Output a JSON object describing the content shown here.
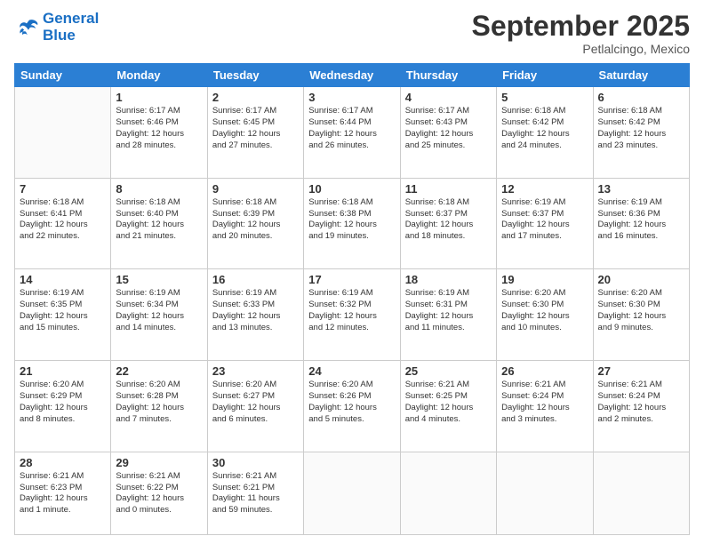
{
  "logo": {
    "line1": "General",
    "line2": "Blue"
  },
  "title": "September 2025",
  "location": "Petlalcingo, Mexico",
  "days_of_week": [
    "Sunday",
    "Monday",
    "Tuesday",
    "Wednesday",
    "Thursday",
    "Friday",
    "Saturday"
  ],
  "weeks": [
    [
      {
        "day": "",
        "content": ""
      },
      {
        "day": "1",
        "content": "Sunrise: 6:17 AM\nSunset: 6:46 PM\nDaylight: 12 hours\nand 28 minutes."
      },
      {
        "day": "2",
        "content": "Sunrise: 6:17 AM\nSunset: 6:45 PM\nDaylight: 12 hours\nand 27 minutes."
      },
      {
        "day": "3",
        "content": "Sunrise: 6:17 AM\nSunset: 6:44 PM\nDaylight: 12 hours\nand 26 minutes."
      },
      {
        "day": "4",
        "content": "Sunrise: 6:17 AM\nSunset: 6:43 PM\nDaylight: 12 hours\nand 25 minutes."
      },
      {
        "day": "5",
        "content": "Sunrise: 6:18 AM\nSunset: 6:42 PM\nDaylight: 12 hours\nand 24 minutes."
      },
      {
        "day": "6",
        "content": "Sunrise: 6:18 AM\nSunset: 6:42 PM\nDaylight: 12 hours\nand 23 minutes."
      }
    ],
    [
      {
        "day": "7",
        "content": "Sunrise: 6:18 AM\nSunset: 6:41 PM\nDaylight: 12 hours\nand 22 minutes."
      },
      {
        "day": "8",
        "content": "Sunrise: 6:18 AM\nSunset: 6:40 PM\nDaylight: 12 hours\nand 21 minutes."
      },
      {
        "day": "9",
        "content": "Sunrise: 6:18 AM\nSunset: 6:39 PM\nDaylight: 12 hours\nand 20 minutes."
      },
      {
        "day": "10",
        "content": "Sunrise: 6:18 AM\nSunset: 6:38 PM\nDaylight: 12 hours\nand 19 minutes."
      },
      {
        "day": "11",
        "content": "Sunrise: 6:18 AM\nSunset: 6:37 PM\nDaylight: 12 hours\nand 18 minutes."
      },
      {
        "day": "12",
        "content": "Sunrise: 6:19 AM\nSunset: 6:37 PM\nDaylight: 12 hours\nand 17 minutes."
      },
      {
        "day": "13",
        "content": "Sunrise: 6:19 AM\nSunset: 6:36 PM\nDaylight: 12 hours\nand 16 minutes."
      }
    ],
    [
      {
        "day": "14",
        "content": "Sunrise: 6:19 AM\nSunset: 6:35 PM\nDaylight: 12 hours\nand 15 minutes."
      },
      {
        "day": "15",
        "content": "Sunrise: 6:19 AM\nSunset: 6:34 PM\nDaylight: 12 hours\nand 14 minutes."
      },
      {
        "day": "16",
        "content": "Sunrise: 6:19 AM\nSunset: 6:33 PM\nDaylight: 12 hours\nand 13 minutes."
      },
      {
        "day": "17",
        "content": "Sunrise: 6:19 AM\nSunset: 6:32 PM\nDaylight: 12 hours\nand 12 minutes."
      },
      {
        "day": "18",
        "content": "Sunrise: 6:19 AM\nSunset: 6:31 PM\nDaylight: 12 hours\nand 11 minutes."
      },
      {
        "day": "19",
        "content": "Sunrise: 6:20 AM\nSunset: 6:30 PM\nDaylight: 12 hours\nand 10 minutes."
      },
      {
        "day": "20",
        "content": "Sunrise: 6:20 AM\nSunset: 6:30 PM\nDaylight: 12 hours\nand 9 minutes."
      }
    ],
    [
      {
        "day": "21",
        "content": "Sunrise: 6:20 AM\nSunset: 6:29 PM\nDaylight: 12 hours\nand 8 minutes."
      },
      {
        "day": "22",
        "content": "Sunrise: 6:20 AM\nSunset: 6:28 PM\nDaylight: 12 hours\nand 7 minutes."
      },
      {
        "day": "23",
        "content": "Sunrise: 6:20 AM\nSunset: 6:27 PM\nDaylight: 12 hours\nand 6 minutes."
      },
      {
        "day": "24",
        "content": "Sunrise: 6:20 AM\nSunset: 6:26 PM\nDaylight: 12 hours\nand 5 minutes."
      },
      {
        "day": "25",
        "content": "Sunrise: 6:21 AM\nSunset: 6:25 PM\nDaylight: 12 hours\nand 4 minutes."
      },
      {
        "day": "26",
        "content": "Sunrise: 6:21 AM\nSunset: 6:24 PM\nDaylight: 12 hours\nand 3 minutes."
      },
      {
        "day": "27",
        "content": "Sunrise: 6:21 AM\nSunset: 6:24 PM\nDaylight: 12 hours\nand 2 minutes."
      }
    ],
    [
      {
        "day": "28",
        "content": "Sunrise: 6:21 AM\nSunset: 6:23 PM\nDaylight: 12 hours\nand 1 minute."
      },
      {
        "day": "29",
        "content": "Sunrise: 6:21 AM\nSunset: 6:22 PM\nDaylight: 12 hours\nand 0 minutes."
      },
      {
        "day": "30",
        "content": "Sunrise: 6:21 AM\nSunset: 6:21 PM\nDaylight: 11 hours\nand 59 minutes."
      },
      {
        "day": "",
        "content": ""
      },
      {
        "day": "",
        "content": ""
      },
      {
        "day": "",
        "content": ""
      },
      {
        "day": "",
        "content": ""
      }
    ]
  ]
}
